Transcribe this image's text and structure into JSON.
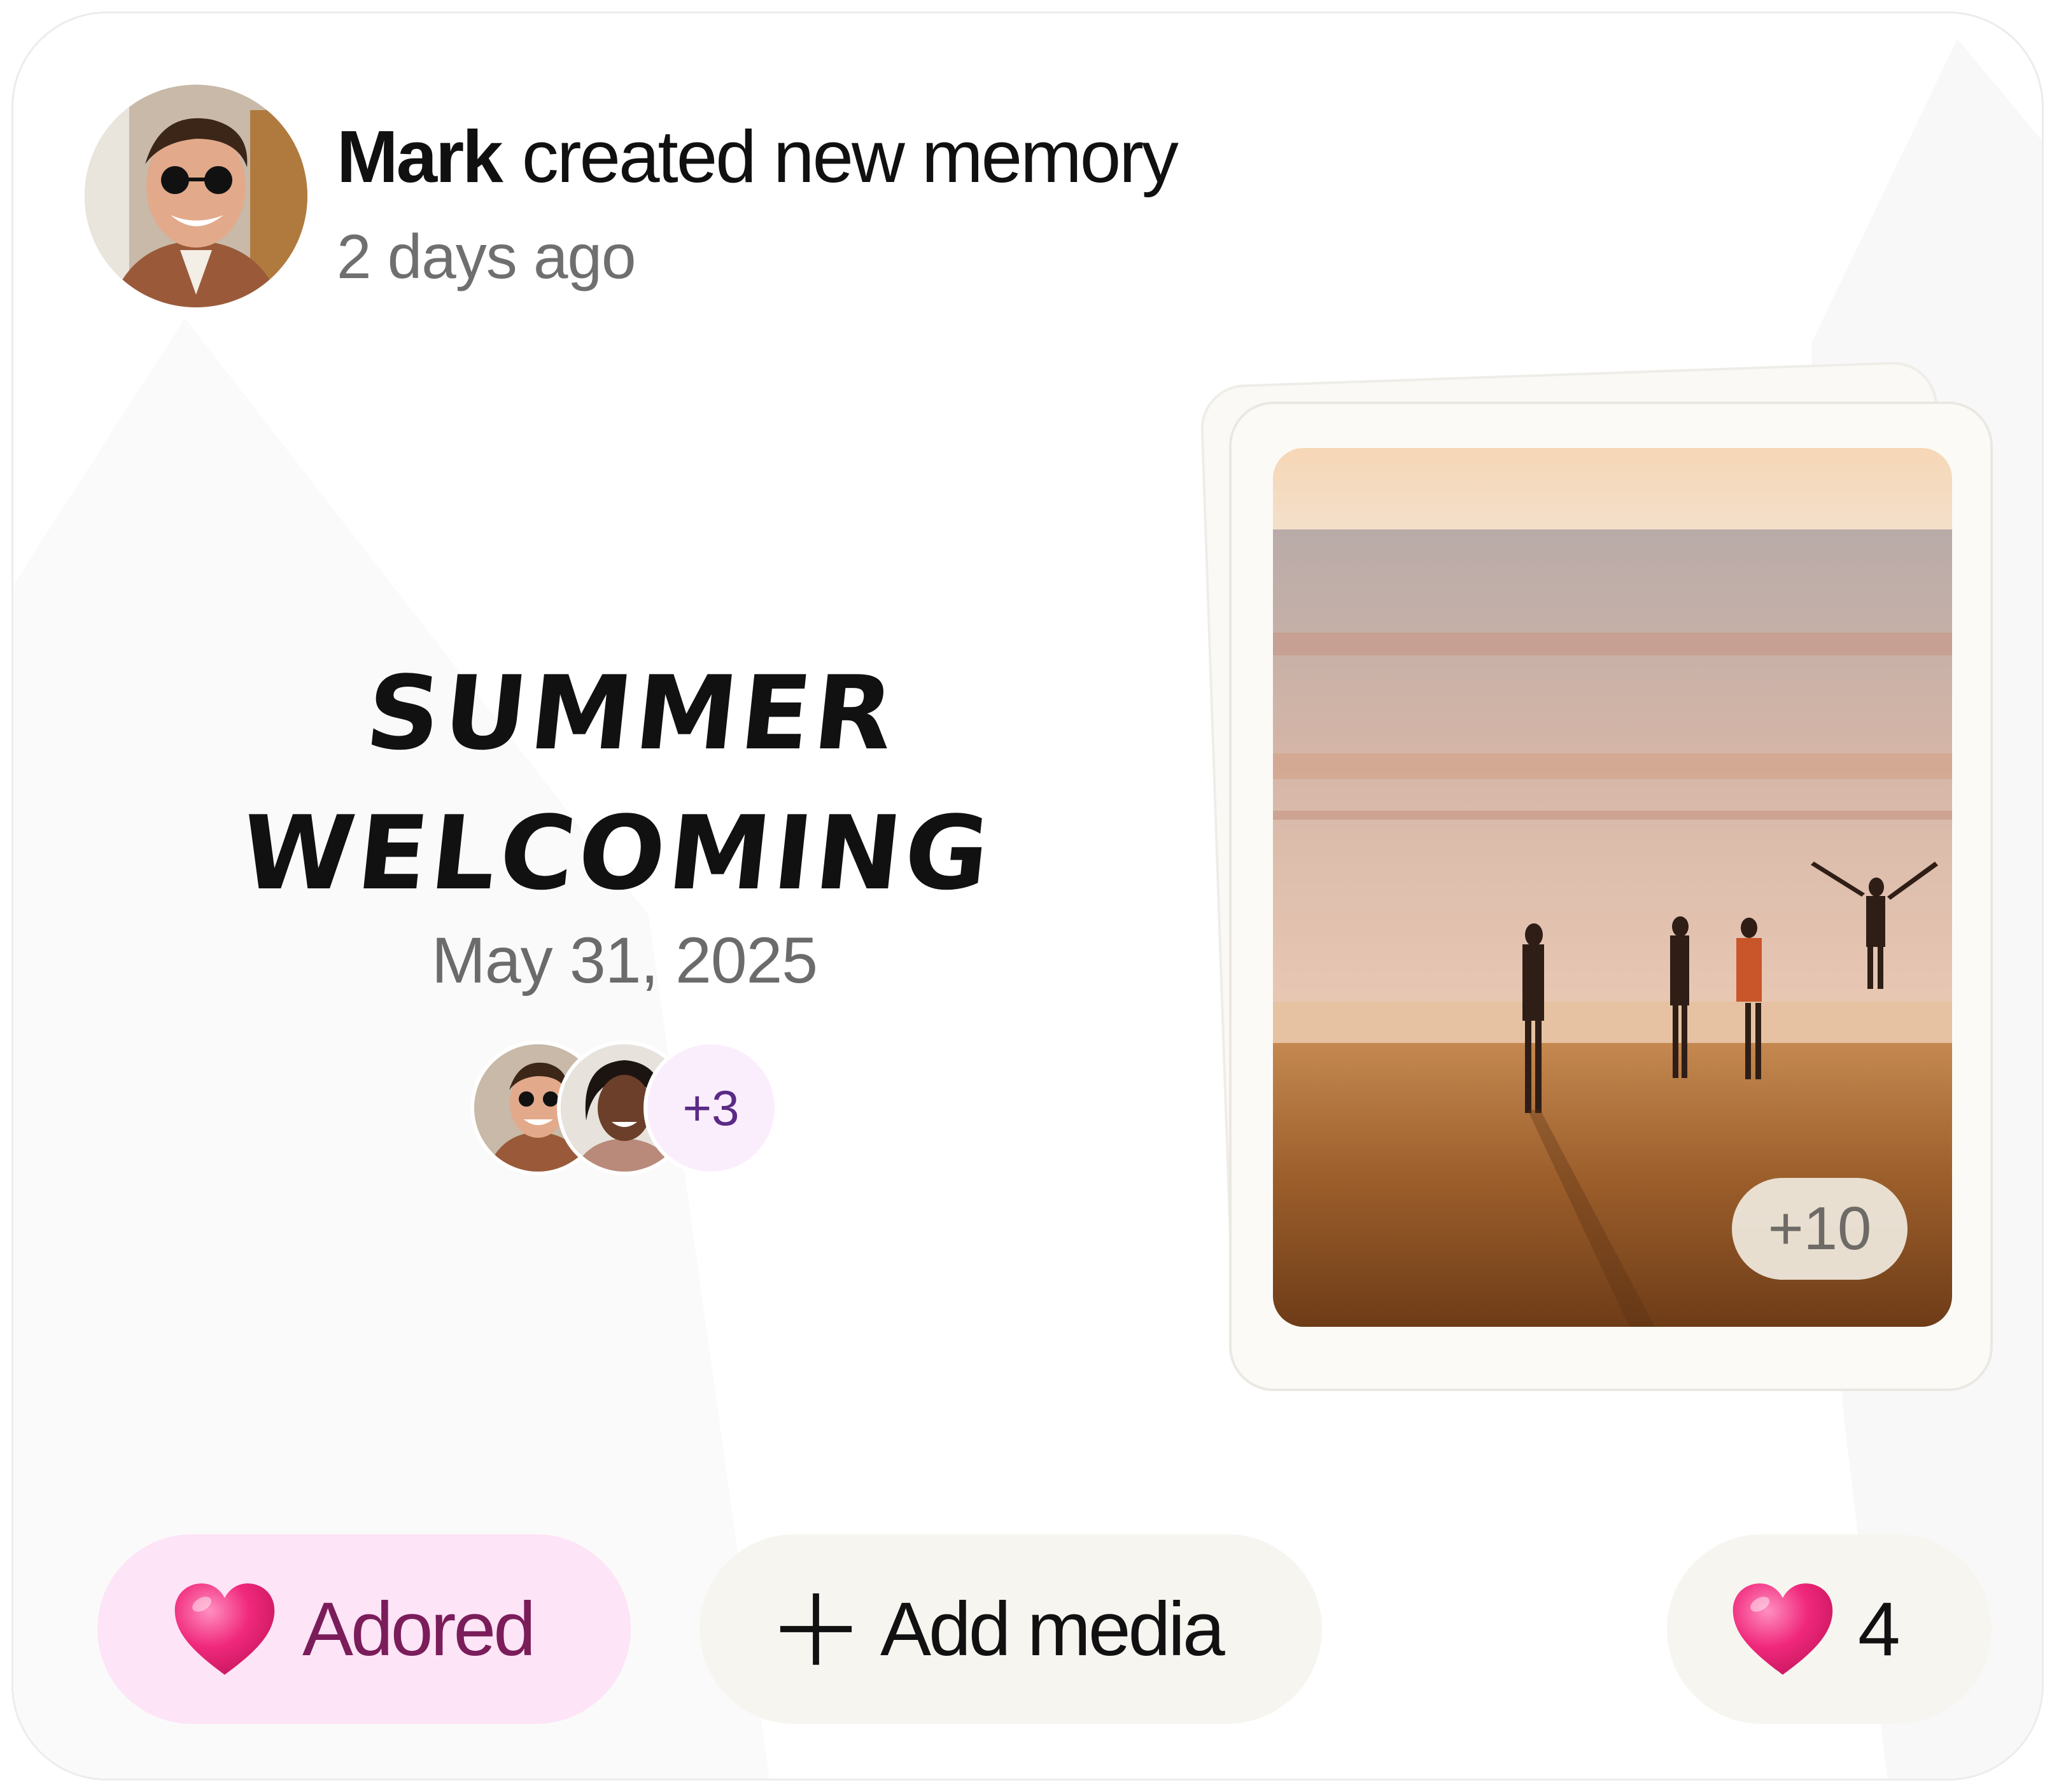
{
  "post": {
    "author": "Mark",
    "action": "created new memory",
    "time_ago": "2 days ago"
  },
  "memory": {
    "title_line1": "SUMMER",
    "title_line2": "WELCOMING",
    "date": "May 31, 2025",
    "participants_more": "+3",
    "photo_more": "+10"
  },
  "actions": {
    "adored_label": "Adored",
    "add_media_label": "Add media",
    "likes_count": "4"
  },
  "icons": {
    "heart": "heart-icon",
    "plus": "plus-icon"
  },
  "colors": {
    "adored_bg": "#fde4f6",
    "adored_text": "#7a1d5a",
    "button_bg": "#f7f5f0",
    "heart": "#f0287c",
    "participants_more_text": "#5a2a86"
  }
}
